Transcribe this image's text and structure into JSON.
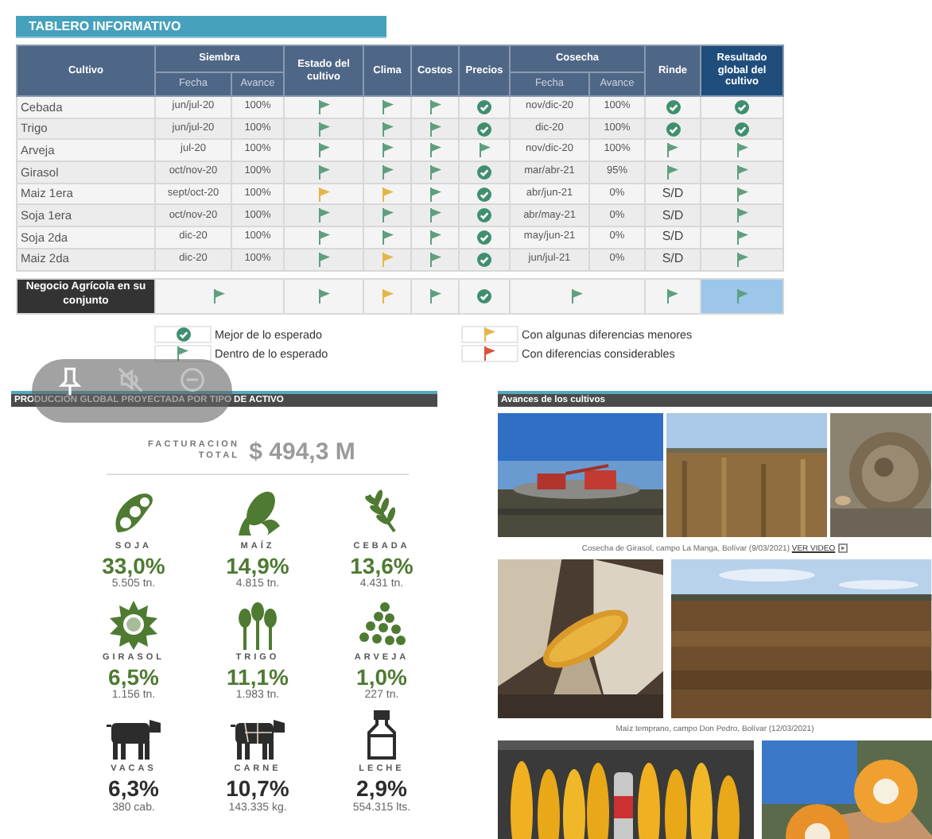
{
  "dashboard": {
    "title": "TABLERO INFORMATIVO"
  },
  "table": {
    "columns": [
      {
        "label": "Cultivo"
      },
      {
        "label": "Siembra",
        "colspan": 2,
        "columns": [
          {
            "label": "Fecha"
          },
          {
            "label": "Avance"
          }
        ]
      },
      {
        "label": "Estado del cultivo"
      },
      {
        "label": "Clima"
      },
      {
        "label": "Costos"
      },
      {
        "label": "Precios"
      },
      {
        "label": "Cosecha",
        "colspan": 2,
        "columns": [
          {
            "label": "Fecha"
          },
          {
            "label": "Avance"
          }
        ]
      },
      {
        "label": "Rinde"
      },
      {
        "label": "Resultado global del cultivo"
      }
    ],
    "rows": [
      {
        "cells": [
          "Cebada",
          "jun/jul-20",
          "100%",
          {
            "kind": "flag",
            "color": "#5f9f80"
          },
          {
            "kind": "flag",
            "color": "#5f9f80"
          },
          {
            "kind": "flag",
            "color": "#5f9f80"
          },
          {
            "kind": "check",
            "color": "#3f8f6f"
          },
          "nov/dic-20",
          "100%",
          {
            "kind": "check",
            "color": "#3f8f6f"
          },
          {
            "kind": "check",
            "color": "#3f8f6f"
          }
        ]
      },
      {
        "cells": [
          "Trigo",
          "jun/jul-20",
          "100%",
          {
            "kind": "flag",
            "color": "#5f9f80"
          },
          {
            "kind": "flag",
            "color": "#5f9f80"
          },
          {
            "kind": "flag",
            "color": "#5f9f80"
          },
          {
            "kind": "check",
            "color": "#3f8f6f"
          },
          "dic-20",
          "100%",
          {
            "kind": "check",
            "color": "#3f8f6f"
          },
          {
            "kind": "check",
            "color": "#3f8f6f"
          }
        ]
      },
      {
        "cells": [
          "Arveja",
          "jul-20",
          "100%",
          {
            "kind": "flag",
            "color": "#5f9f80"
          },
          {
            "kind": "flag",
            "color": "#5f9f80"
          },
          {
            "kind": "flag",
            "color": "#5f9f80"
          },
          {
            "kind": "flag",
            "color": "#5f9f80"
          },
          "nov/dic-20",
          "100%",
          {
            "kind": "flag",
            "color": "#5f9f80"
          },
          {
            "kind": "flag",
            "color": "#5f9f80"
          }
        ]
      },
      {
        "cells": [
          "Girasol",
          "oct/nov-20",
          "100%",
          {
            "kind": "flag",
            "color": "#5f9f80"
          },
          {
            "kind": "flag",
            "color": "#5f9f80"
          },
          {
            "kind": "flag",
            "color": "#5f9f80"
          },
          {
            "kind": "check",
            "color": "#3f8f6f"
          },
          "mar/abr-21",
          "95%",
          {
            "kind": "flag",
            "color": "#5f9f80"
          },
          {
            "kind": "flag",
            "color": "#5f9f80"
          }
        ]
      },
      {
        "cells": [
          "Maiz 1era",
          "sept/oct-20",
          "100%",
          {
            "kind": "flag",
            "color": "#e6b54a"
          },
          {
            "kind": "flag",
            "color": "#e6b54a"
          },
          {
            "kind": "flag",
            "color": "#5f9f80"
          },
          {
            "kind": "check",
            "color": "#3f8f6f"
          },
          "abr/jun-21",
          "0%",
          "S/D",
          {
            "kind": "flag",
            "color": "#5f9f80"
          }
        ]
      },
      {
        "cells": [
          "Soja 1era",
          "oct/nov-20",
          "100%",
          {
            "kind": "flag",
            "color": "#5f9f80"
          },
          {
            "kind": "flag",
            "color": "#5f9f80"
          },
          {
            "kind": "flag",
            "color": "#5f9f80"
          },
          {
            "kind": "check",
            "color": "#3f8f6f"
          },
          "abr/may-21",
          "0%",
          "S/D",
          {
            "kind": "flag",
            "color": "#5f9f80"
          }
        ]
      },
      {
        "cells": [
          "Soja 2da",
          "dic-20",
          "100%",
          {
            "kind": "flag",
            "color": "#5f9f80"
          },
          {
            "kind": "flag",
            "color": "#5f9f80"
          },
          {
            "kind": "flag",
            "color": "#5f9f80"
          },
          {
            "kind": "check",
            "color": "#3f8f6f"
          },
          "may/jun-21",
          "0%",
          "S/D",
          {
            "kind": "flag",
            "color": "#5f9f80"
          }
        ]
      },
      {
        "cells": [
          "Maiz 2da",
          "dic-20",
          "100%",
          {
            "kind": "flag",
            "color": "#5f9f80"
          },
          {
            "kind": "flag",
            "color": "#e6b54a"
          },
          {
            "kind": "flag",
            "color": "#5f9f80"
          },
          {
            "kind": "check",
            "color": "#3f8f6f"
          },
          "jun/jul-21",
          "0%",
          "S/D",
          {
            "kind": "flag",
            "color": "#5f9f80"
          }
        ]
      }
    ],
    "total": {
      "label": "Negocio Agrícola en su conjunto",
      "marks": [
        {
          "kind": "flag",
          "color": "#5f9f80"
        },
        {
          "kind": "flag",
          "color": "#5f9f80"
        },
        {
          "kind": "flag",
          "color": "#e6b54a"
        },
        {
          "kind": "flag",
          "color": "#5f9f80"
        },
        {
          "kind": "check",
          "color": "#3f8f6f"
        },
        {
          "kind": "flag",
          "color": "#5f9f80"
        },
        {
          "kind": "flag",
          "color": "#5f9f80"
        },
        {
          "kind": "flag",
          "color": "#5f9f80"
        }
      ]
    }
  },
  "legend": [
    {
      "kind": "check",
      "color": "#3f8f6f",
      "text": "Mejor de lo esperado"
    },
    {
      "kind": "flag",
      "color": "#e6b54a",
      "text": "Con algunas diferencias menores"
    },
    {
      "kind": "flag",
      "color": "#5f9f80",
      "text": "Dentro de lo esperado"
    },
    {
      "kind": "flag",
      "color": "#d9533a",
      "text": "Con diferencias considerables"
    }
  ],
  "production": {
    "title": "PRODUCCIÓN GLOBAL PROYECTADA POR TIPO DE ACTIVO",
    "total_label": "FACTURACION TOTAL",
    "total_value": "$ 494,3 M",
    "items": [
      {
        "kind": "crop",
        "name": "SOJA",
        "share": "33,0%",
        "amount": "5.505 tn."
      },
      {
        "kind": "crop",
        "name": "MAÍZ",
        "share": "14,9%",
        "amount": "4.815 tn."
      },
      {
        "kind": "crop",
        "name": "CEBADA",
        "share": "13,6%",
        "amount": "4.431 tn."
      },
      {
        "kind": "crop",
        "name": "GIRASOL",
        "share": "6,5%",
        "amount": "1.156 tn."
      },
      {
        "kind": "crop",
        "name": "TRIGO",
        "share": "11,1%",
        "amount": "1.983 tn."
      },
      {
        "kind": "crop",
        "name": "ARVEJA",
        "share": "1,0%",
        "amount": "227 tn."
      },
      {
        "kind": "livestock",
        "name": "VACAS",
        "share": "6,3%",
        "amount": "380 cab."
      },
      {
        "kind": "livestock",
        "name": "CARNE",
        "share": "10,7%",
        "amount": "143.335 kg."
      },
      {
        "kind": "livestock",
        "name": "LECHE",
        "share": "2,9%",
        "amount": "554.315 lts."
      }
    ]
  },
  "gallery": {
    "title": "Avances de los cultivos",
    "captions": [
      {
        "text": "Cosecha de Girasol, campo La Manga, Bolívar (9/03/2021)",
        "link": "VER VIDEO"
      },
      {
        "text": "Maíz temprano, campo Don Pedro, Bolívar (12/03/2021)"
      }
    ]
  }
}
